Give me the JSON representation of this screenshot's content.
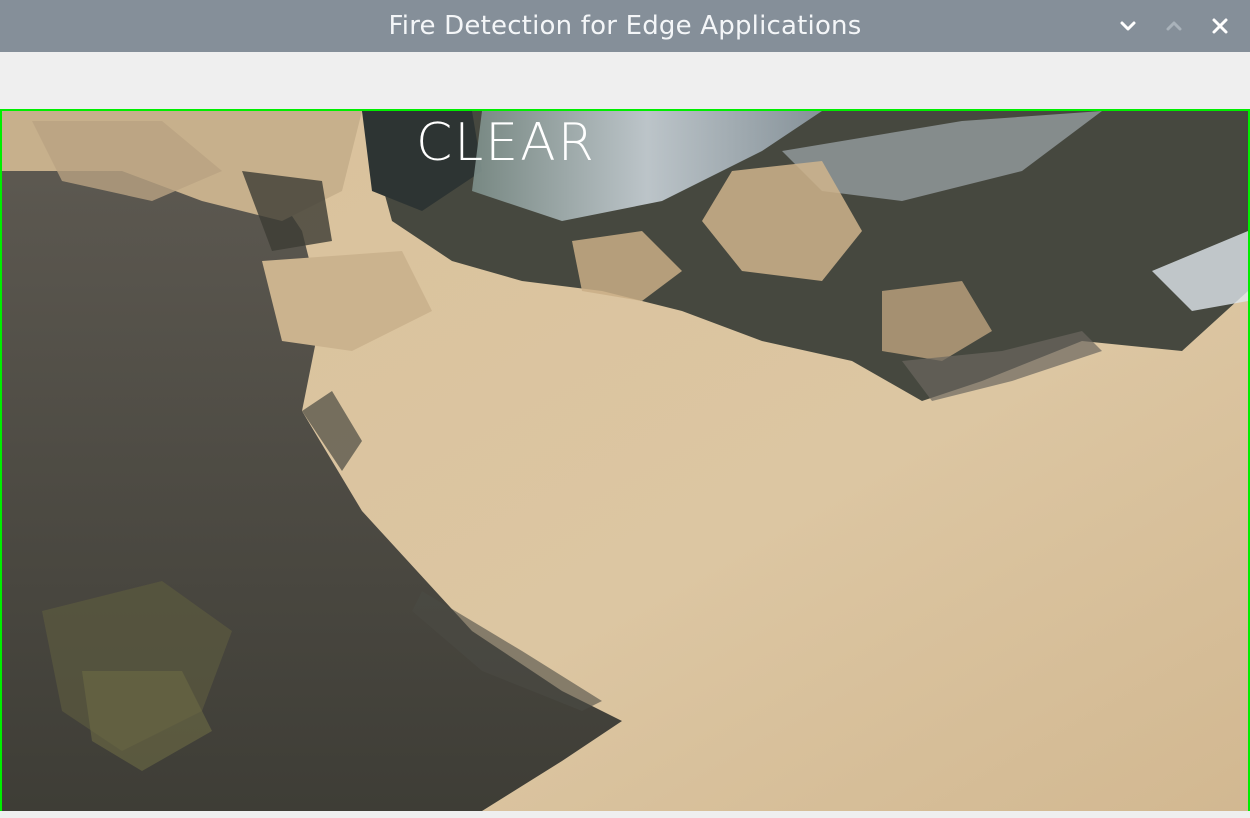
{
  "window": {
    "title": "Fire Detection for Edge Applications",
    "controls": [
      {
        "name": "minimize-icon",
        "glyph": "chevron-down-icon"
      },
      {
        "name": "maximize-icon",
        "glyph": "chevron-up-icon"
      },
      {
        "name": "close-icon",
        "glyph": "close-icon"
      }
    ]
  },
  "video": {
    "status_label": "CLEAR",
    "border_color": "#00ee00"
  }
}
